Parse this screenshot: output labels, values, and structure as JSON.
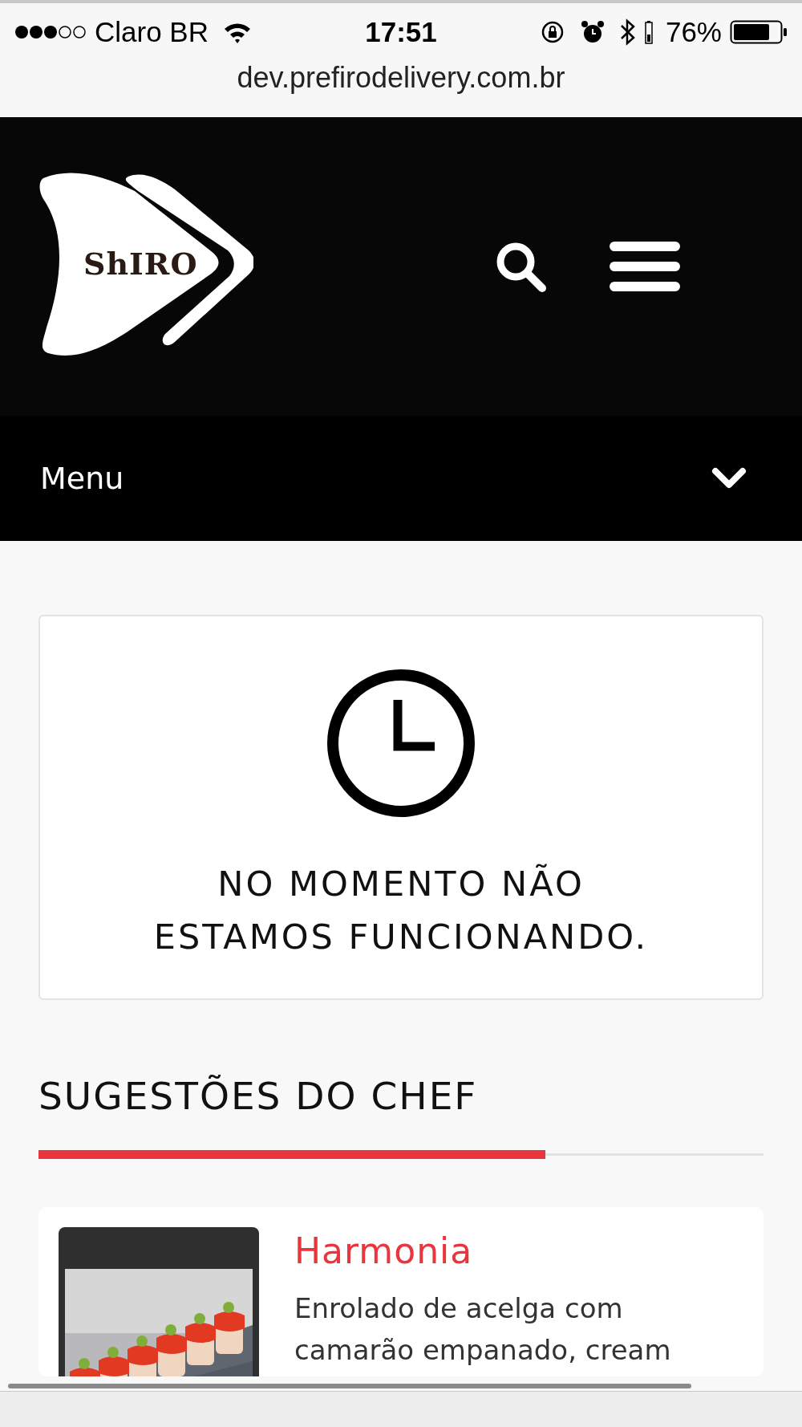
{
  "status_bar": {
    "carrier": "Claro BR",
    "time": "17:51",
    "battery": "76%"
  },
  "address_bar": {
    "url": "dev.prefirodelivery.com.br"
  },
  "header": {
    "logo_text": "ShIRO"
  },
  "menu_bar": {
    "label": "Menu",
    "expanded": false
  },
  "notice": {
    "lines": [
      "NO MOMENTO NÃO",
      "ESTAMOS FUNCIONANDO."
    ]
  },
  "section": {
    "title": "SUGESTÕES DO CHEF"
  },
  "products": [
    {
      "name": "Harmonia",
      "description_lines": [
        "Enrolado de acelga com",
        "camarão empanado, cream"
      ]
    }
  ]
}
